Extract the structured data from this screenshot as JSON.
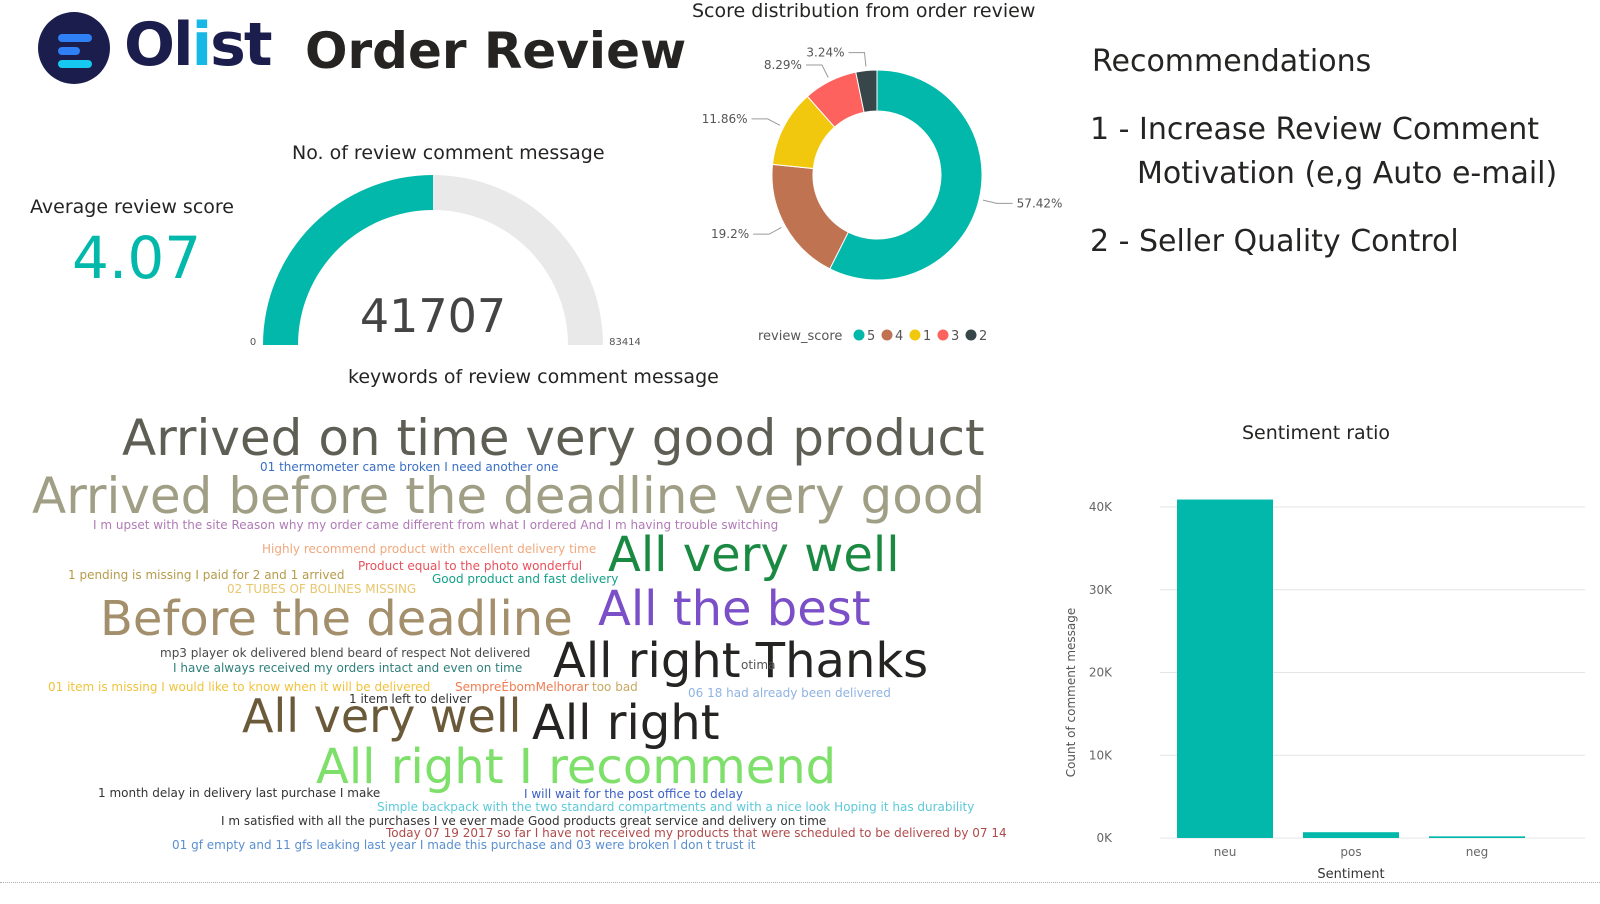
{
  "header": {
    "logo_text_part1": "Ol",
    "logo_text_part2": "i",
    "logo_text_part3": "st",
    "title": "Order Review"
  },
  "kpi": {
    "label": "Average review score",
    "value": "4.07"
  },
  "colors": {
    "teal": "#01b8aa",
    "brown": "#c07350",
    "yellow": "#f2c80f",
    "red": "#fd625e",
    "dark": "#374649",
    "track": "#e9e9e9"
  },
  "recommendations": {
    "title": "Recommendations",
    "line1": "1 - Increase Review Comment",
    "line1b": "Motivation (e,g Auto e-mail)",
    "line2": "2 - Seller Quality Control"
  },
  "wordcloud": {
    "title": "keywords of review comment message",
    "words": [
      {
        "text": "Arrived on time very good product",
        "color": "#5e5e55"
      },
      {
        "text": "01 thermometer came broken I need another one",
        "color": "#3a6fc4"
      },
      {
        "text": "Arrived before the deadline very good",
        "color": "#a09f86"
      },
      {
        "text": "I m upset with the site Reason why my order came different from what I ordered And I m having trouble switching",
        "color": "#b07ab6"
      },
      {
        "text": "Highly recommend product with excellent delivery time",
        "color": "#f0a87c"
      },
      {
        "text": "All very well",
        "color": "#1a8a43"
      },
      {
        "text": "Product equal to the photo wonderful",
        "color": "#e8505b"
      },
      {
        "text": "1 pending is missing I paid for 2 and 1 arrived",
        "color": "#b59b4a"
      },
      {
        "text": "Good product and fast delivery",
        "color": "#14a08a"
      },
      {
        "text": "02 TUBES OF BOLINES MISSING",
        "color": "#e8c66d"
      },
      {
        "text": "Before the deadline",
        "color": "#a38f6b"
      },
      {
        "text": "All the best",
        "color": "#7b4fc7"
      },
      {
        "text": "mp3 player ok delivered blend beard of respect Not delivered",
        "color": "#4a4a4a"
      },
      {
        "text": "All right Thanks",
        "color": "#252423"
      },
      {
        "text": "I have always received my orders intact and even on time",
        "color": "#2e7f7a"
      },
      {
        "text": "otima",
        "color": "#555555"
      },
      {
        "text": "01 item is missing I would like to know when it will be delivered",
        "color": "#f0c33c"
      },
      {
        "text": "SempreÉbomMelhorar",
        "color": "#f07b52"
      },
      {
        "text": "too bad",
        "color": "#c9a860"
      },
      {
        "text": "06 18 had already been delivered",
        "color": "#8fb3e3"
      },
      {
        "text": "1 item left to deliver",
        "color": "#333333"
      },
      {
        "text": "All very well",
        "color": "#6b5a3a"
      },
      {
        "text": "All right",
        "color": "#252423"
      },
      {
        "text": "All right I recommend",
        "color": "#7ee06a"
      },
      {
        "text": "1 month delay in delivery last purchase I make",
        "color": "#333333"
      },
      {
        "text": "I will wait for the post office to delay",
        "color": "#3a5fc4"
      },
      {
        "text": "Simple backpack with the two standard compartments and with a nice look Hoping it has durability",
        "color": "#5cc8d8"
      },
      {
        "text": "I m satisfied with all the purchases I ve ever made Good products great service and delivery on time",
        "color": "#333333"
      },
      {
        "text": "Today 07 19 2017 so far I have not received my products that were scheduled to be delivered by 07 14",
        "color": "#b04a4a"
      },
      {
        "text": "01 gf empty and 11 gfs leaking last year I made this purchase and 03 were broken I don t trust it",
        "color": "#5a8fd0"
      }
    ]
  },
  "chart_data": [
    {
      "type": "gauge",
      "title": "No. of review comment message",
      "value": 41707,
      "min": 0,
      "max": 83414,
      "value_label": "41707",
      "min_label": "0",
      "max_label": "83414"
    },
    {
      "type": "pie",
      "subtype": "donut",
      "title": "Score distribution from order review",
      "legend_title": "review_score",
      "legend_position": "bottom",
      "slices": [
        {
          "label": "5",
          "value": 57.42,
          "value_label": "57.42%",
          "color": "#01b8aa"
        },
        {
          "label": "4",
          "value": 19.2,
          "value_label": "19.2%",
          "color": "#c07350"
        },
        {
          "label": "1",
          "value": 11.86,
          "value_label": "11.86%",
          "color": "#f2c80f"
        },
        {
          "label": "3",
          "value": 8.29,
          "value_label": "8.29%",
          "color": "#fd625e"
        },
        {
          "label": "2",
          "value": 3.24,
          "value_label": "3.24%",
          "color": "#374649"
        }
      ]
    },
    {
      "type": "bar",
      "title": "Sentiment ratio",
      "xlabel": "Sentiment",
      "ylabel": "Count of comment message",
      "categories": [
        "neu",
        "pos",
        "neg"
      ],
      "values": [
        40900,
        700,
        200
      ],
      "ylim": [
        0,
        40000
      ],
      "yticks": [
        0,
        10000,
        20000,
        30000,
        40000
      ],
      "ytick_labels": [
        "0K",
        "10K",
        "20K",
        "30K",
        "40K"
      ],
      "grid": true,
      "color": "#01b8aa"
    }
  ]
}
